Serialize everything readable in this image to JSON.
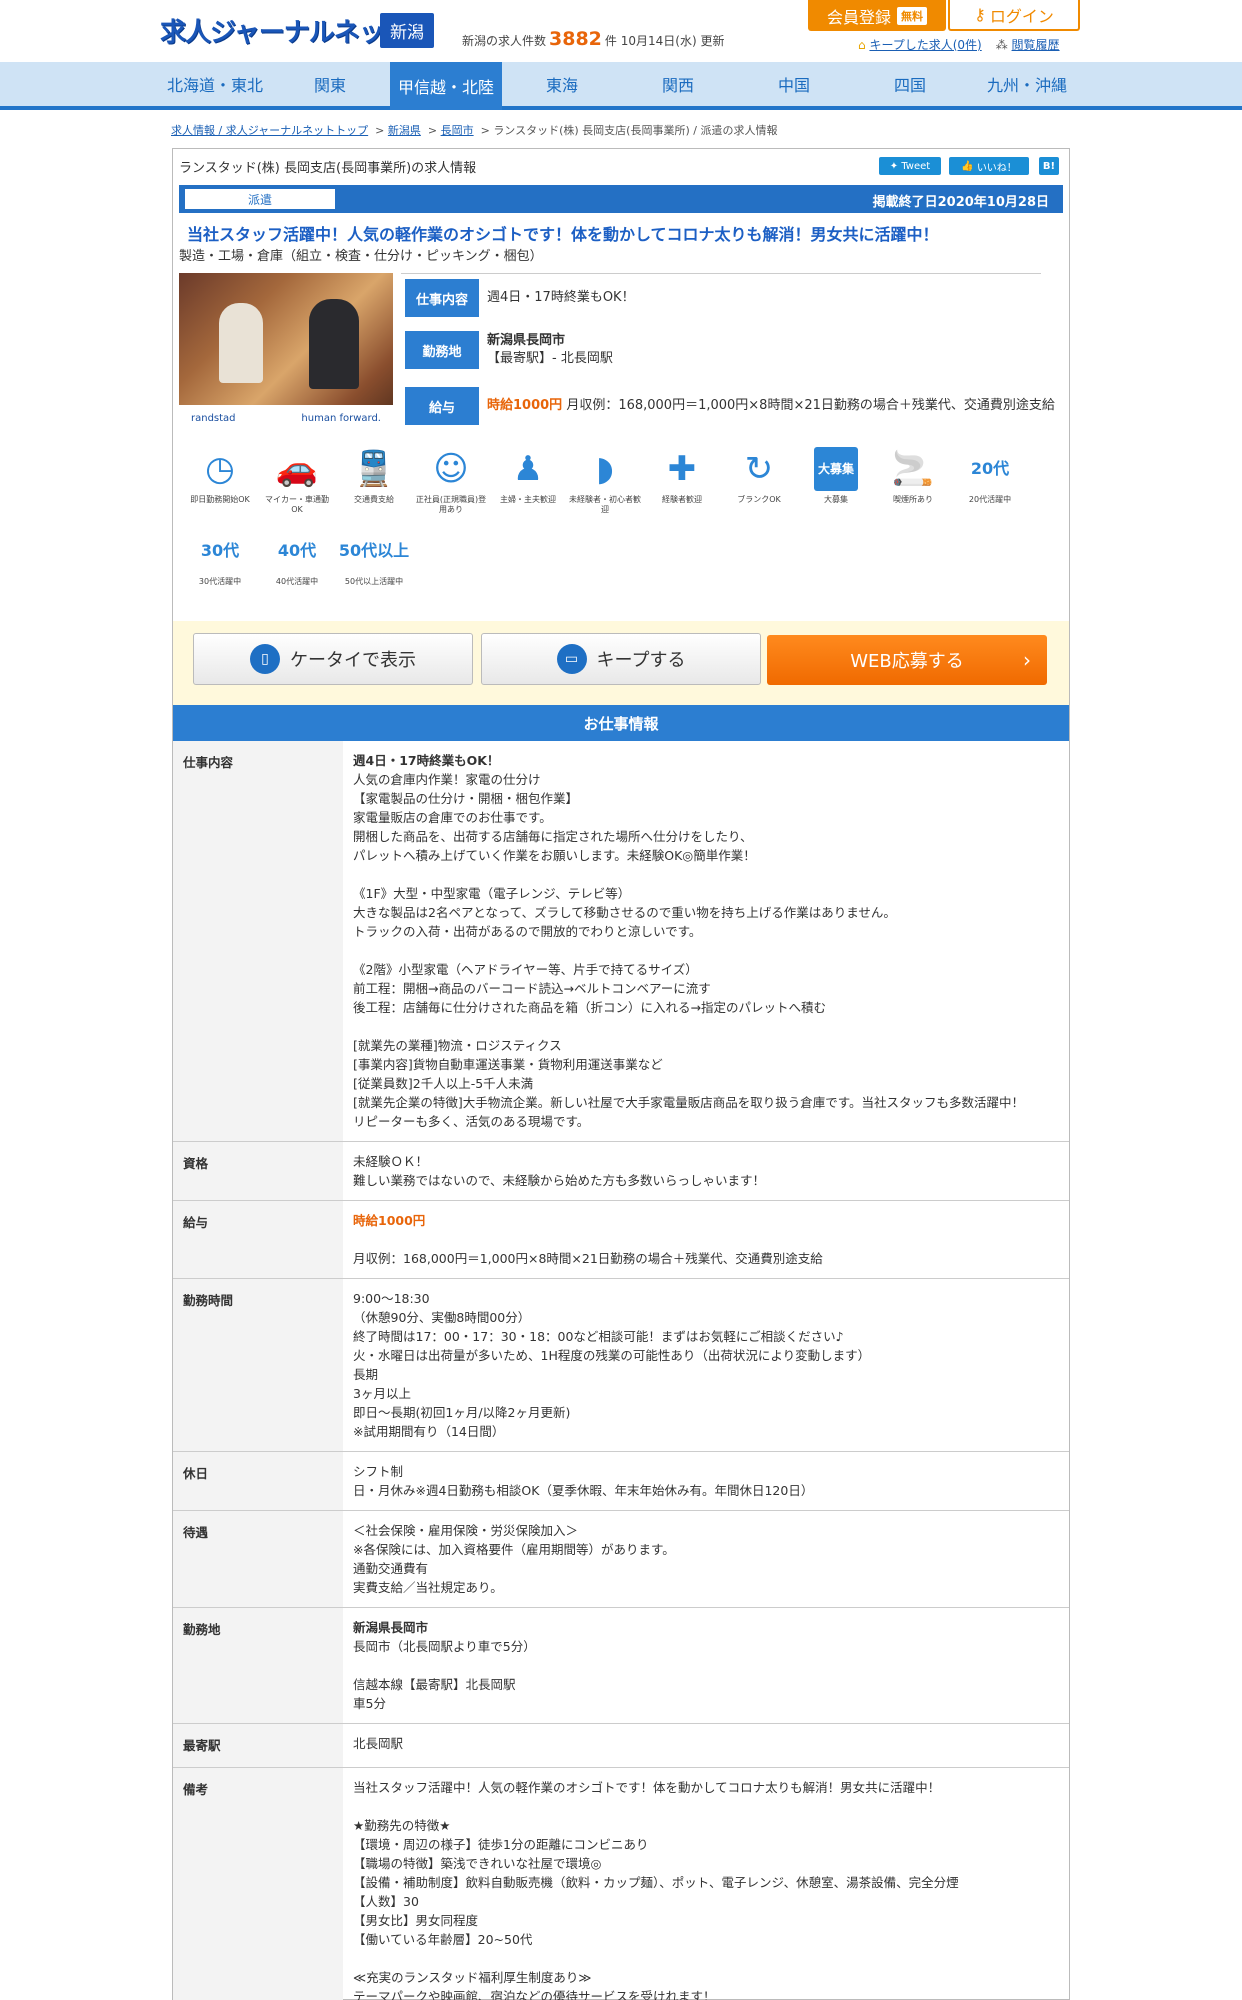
{
  "header": {
    "logo": "求人ジャーナルネット",
    "pref": "新潟",
    "count_prefix": "新潟の求人件数",
    "count": "3882",
    "count_suffix": "件 10月14日(水) 更新",
    "register": "会員登録",
    "free": "無料",
    "login": "ログイン",
    "keep": "キープした求人(0件)",
    "history": "閲覧履歴"
  },
  "nav": [
    "北海道・東北",
    "関東",
    "甲信越・北陸",
    "東海",
    "関西",
    "中国",
    "四国",
    "九州・沖縄"
  ],
  "breadcrumb": {
    "top": "求人情報 / 求人ジャーナルネットトップ",
    "pref": "新潟県",
    "city": "長岡市",
    "current": "ランスタッド(株) 長岡支店(長岡事業所) / 派遣の求人情報"
  },
  "job": {
    "company": "ランスタッド(株) 長岡支店(長岡事業所)の求人情報",
    "tweet": "Tweet",
    "like": "いいね！",
    "hatena": "B!",
    "type": "派遣",
    "end_date": "掲載終了日2020年10月28日",
    "headline": "当社スタッフ活躍中！人気の軽作業のオシゴトです！体を動かしてコロナ太りも解消！男女共に活躍中！",
    "category": "製造・工場・倉庫（組立・検査・仕分け・ピッキング・梱包）",
    "photo_brand": "randstad",
    "photo_tag": "human forward.",
    "tags": {
      "work": "仕事内容",
      "place": "勤務地",
      "pay": "給与"
    },
    "work_summary": "週4日・17時終業もOK！",
    "place_pref": "新潟県長岡市",
    "place_station": "【最寄駅】- 北長岡駅",
    "pay_hourly": "時給1000円",
    "pay_detail": " 月収例：168,000円＝1,000円×8時間×21日勤務の場合＋残業代、交通費別途支給"
  },
  "features": [
    {
      "icon": "clock-icon",
      "glyph": "◷",
      "label": "即日勤務開始OK"
    },
    {
      "icon": "car-icon",
      "glyph": "🚗",
      "label": "マイカー・車通勤OK"
    },
    {
      "icon": "train-icon",
      "glyph": "🚆",
      "label": "交通費支給"
    },
    {
      "icon": "employee-icon",
      "glyph": "☺",
      "label": "正社員(正規職員)登用あり"
    },
    {
      "icon": "homemaker-icon",
      "glyph": "♟",
      "label": "主婦・主夫歓迎"
    },
    {
      "icon": "beginner-icon",
      "glyph": "◗",
      "label": "未経験者・初心者歓迎"
    },
    {
      "icon": "experienced-icon",
      "glyph": "✚",
      "label": "経験者歓迎"
    },
    {
      "icon": "blank-icon",
      "glyph": "↻",
      "label": "ブランクOK"
    },
    {
      "icon": "mass-hiring-icon",
      "glyph": "大募集",
      "label": "大募集"
    },
    {
      "icon": "smoking-area-icon",
      "glyph": "🚬",
      "label": "喫煙所あり"
    },
    {
      "icon": "age20-icon",
      "glyph": "20代",
      "label": "20代活躍中"
    },
    {
      "icon": "age30-icon",
      "glyph": "30代",
      "label": "30代活躍中"
    },
    {
      "icon": "age40-icon",
      "glyph": "40代",
      "label": "40代活躍中"
    },
    {
      "icon": "age50-icon",
      "glyph": "50代以上",
      "label": "50代以上活躍中"
    }
  ],
  "actions": {
    "mobile": "ケータイで表示",
    "keep": "キープする",
    "apply": "WEB応募する"
  },
  "section_title": "お仕事情報",
  "details": [
    {
      "label": "仕事内容",
      "lead": "週4日・17時終業もOK！",
      "text": "人気の倉庫内作業！家電の仕分け\n【家電製品の仕分け・開梱・梱包作業】\n家電量販店の倉庫でのお仕事です。\n開梱した商品を、出荷する店舗毎に指定された場所へ仕分けをしたり、\nパレットへ積み上げていく作業をお願いします。未経験OK◎簡単作業！\n\n《1F》大型・中型家電（電子レンジ、テレビ等）\n大きな製品は2名ペアとなって、ズラして移動させるので重い物を持ち上げる作業はありません。\nトラックの入荷・出荷があるので開放的でわりと涼しいです。\n\n《2階》小型家電（ヘアドライヤー等、片手で持てるサイズ）\n前工程：開梱→商品のバーコード読込→ベルトコンベアーに流す\n後工程：店舗毎に仕分けされた商品を箱（折コン）に入れる→指定のパレットへ積む\n\n[就業先の業種]物流・ロジスティクス\n[事業内容]貨物自動車運送事業・貨物利用運送事業など\n[従業員数]2千人以上-5千人未満\n[就業先企業の特徴]大手物流企業。新しい社屋で大手家電量販店商品を取り扱う倉庫です。当社スタッフも多数活躍中！\nリピーターも多く、活気のある現場です。"
    },
    {
      "label": "資格",
      "lead": "",
      "text": "未経験ＯＫ！\n難しい業務ではないので、未経験から始めた方も多数いらっしゃいます！"
    },
    {
      "label": "給与",
      "lead": "時給1000円",
      "text": "\n月収例：168,000円＝1,000円×8時間×21日勤務の場合＋残業代、交通費別途支給"
    },
    {
      "label": "勤務時間",
      "lead": "",
      "text": "9:00～18:30\n（休憩90分、実働8時間00分）\n終了時間は17：00・17：30・18：00など相談可能！まずはお気軽にご相談ください♪\n火・水曜日は出荷量が多いため、1H程度の残業の可能性あり（出荷状況により変動します）\n長期\n3ヶ月以上\n即日～長期(初回1ヶ月/以降2ヶ月更新)\n※試用期間有り（14日間）"
    },
    {
      "label": "休日",
      "lead": "",
      "text": "シフト制\n日・月休み※週4日勤務も相談OK（夏季休暇、年末年始休み有。年間休日120日）"
    },
    {
      "label": "待遇",
      "lead": "",
      "text": "＜社会保険・雇用保険・労災保険加入＞\n※各保険には、加入資格要件（雇用期間等）があります。\n通勤交通費有\n実費支給／当社規定あり。"
    },
    {
      "label": "勤務地",
      "lead": "新潟県長岡市",
      "text": "長岡市（北長岡駅より車で5分）\n\n信越本線【最寄駅】北長岡駅\n車5分"
    },
    {
      "label": "最寄駅",
      "lead": "",
      "text": "北長岡駅"
    },
    {
      "label": "備考",
      "lead": "",
      "text": "当社スタッフ活躍中！人気の軽作業のオシゴトです！体を動かしてコロナ太りも解消！男女共に活躍中！\n\n★勤務先の特徴★\n【環境・周辺の様子】徒歩1分の距離にコンビニあり\n【職場の特徴】築浅できれいな社屋で環境◎\n【設備・補助制度】飲料自動販売機（飲料・カップ麺）、ポット、電子レンジ、休憩室、湯茶設備、完全分煙\n【人数】30\n【男女比】男女同程度\n【働いている年齢層】20~50代\n\n≪充実のランスタッド福利厚生制度あり≫\nテーマパークや映画館、宿泊などの優待サービスを受けれます！"
    }
  ]
}
